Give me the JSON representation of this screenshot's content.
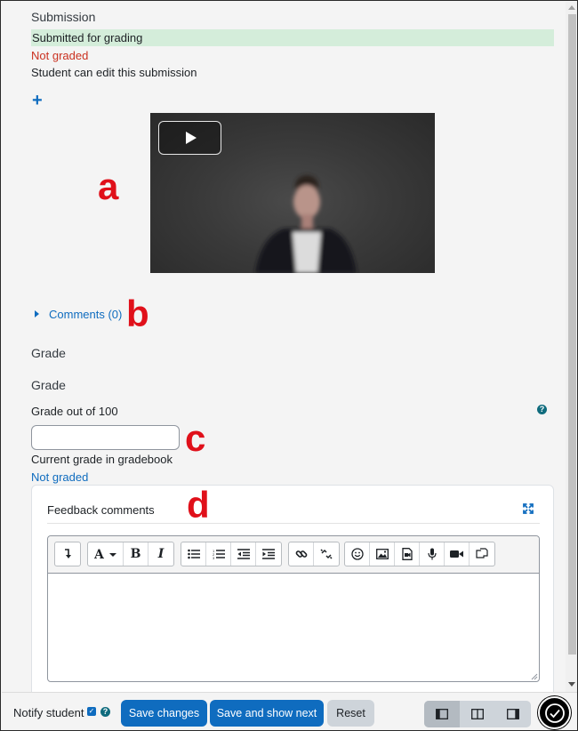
{
  "submission": {
    "title": "Submission",
    "status": "Submitted for grading",
    "grading_status": "Not graded",
    "edit_status": "Student can edit this submission"
  },
  "annotations": {
    "a": "a",
    "b": "b",
    "c": "c",
    "d": "d"
  },
  "comments_link": "Comments (0)",
  "grade": {
    "section_title": "Grade",
    "subtitle": "Grade",
    "grade_label": "Grade out of 100",
    "input_value": "",
    "current_label": "Current grade in gradebook",
    "current_value": "Not graded"
  },
  "feedback": {
    "title": "Feedback comments",
    "editor_text": ""
  },
  "toolbar_icons": [
    "collapse-toolbar-icon",
    "font-style-icon",
    "bold-icon",
    "italic-icon",
    "unordered-list-icon",
    "ordered-list-icon",
    "outdent-icon",
    "indent-icon",
    "link-icon",
    "unlink-icon",
    "emoji-icon",
    "image-icon",
    "media-icon",
    "record-audio-icon",
    "record-video-icon",
    "manage-files-icon"
  ],
  "footer": {
    "notify_label": "Notify student",
    "notify_checked": true,
    "save_changes": "Save changes",
    "save_next": "Save and show next",
    "reset": "Reset"
  },
  "colors": {
    "primary": "#0f6cbf",
    "submitted_bg": "#d4edda",
    "not_graded_red": "#ca3120",
    "annotation_red": "#e0101a"
  }
}
